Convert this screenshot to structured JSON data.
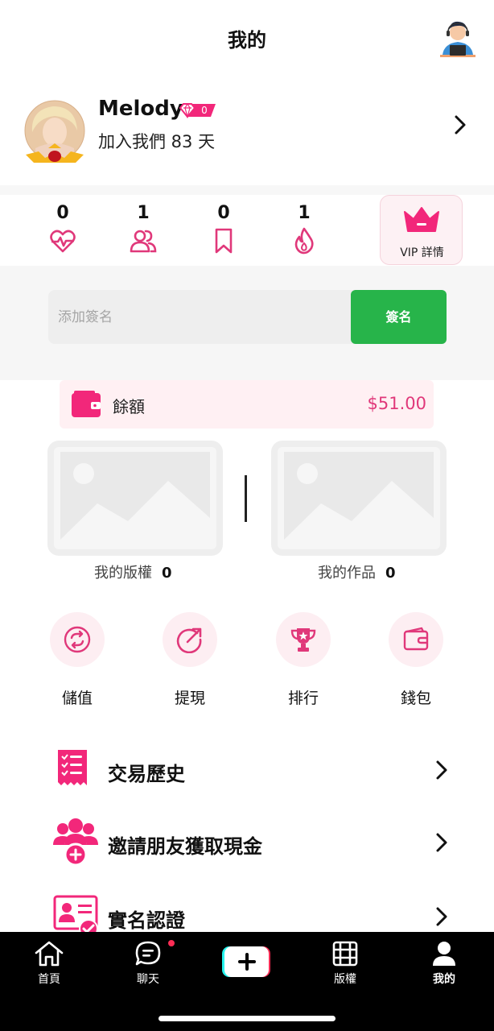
{
  "header": {
    "title": "我的"
  },
  "profile": {
    "name": "Melody",
    "vip_level": "0",
    "joined_text": "加入我們 83 天"
  },
  "stats": [
    {
      "value": "0",
      "icon": "heartbeat-icon"
    },
    {
      "value": "1",
      "icon": "users-icon"
    },
    {
      "value": "0",
      "icon": "bookmark-icon"
    },
    {
      "value": "1",
      "icon": "flame-icon"
    }
  ],
  "vip_card": {
    "label": "VIP 詳情",
    "icon": "crown-icon"
  },
  "signature": {
    "placeholder": "添加簽名",
    "button_label": "簽名"
  },
  "balance": {
    "label": "餘額",
    "value": "$51.00",
    "icon": "wallet-icon"
  },
  "works": {
    "copyright_label": "我的版權",
    "copyright_count": "0",
    "works_label": "我的作品",
    "works_count": "0"
  },
  "actions": [
    {
      "label": "儲值",
      "icon": "recharge-icon"
    },
    {
      "label": "提現",
      "icon": "withdraw-icon"
    },
    {
      "label": "排行",
      "icon": "trophy-icon"
    },
    {
      "label": "錢包",
      "icon": "wallet-icon"
    }
  ],
  "menu": [
    {
      "label": "交易歷史",
      "icon": "transaction-history-icon"
    },
    {
      "label": "邀請朋友獲取現金",
      "icon": "invite-friends-icon"
    },
    {
      "label": "實名認證",
      "icon": "id-verification-icon"
    }
  ],
  "tabbar": [
    {
      "label": "首頁",
      "icon": "home-icon"
    },
    {
      "label": "聊天",
      "icon": "chat-icon",
      "has_notification": true
    },
    {
      "label": "",
      "icon": "plus-icon"
    },
    {
      "label": "版權",
      "icon": "film-icon"
    },
    {
      "label": "我的",
      "icon": "person-icon",
      "active": true
    }
  ],
  "colors": {
    "accent": "#e0387a",
    "sign_button": "#27b44a",
    "tabbar": "#000000"
  }
}
